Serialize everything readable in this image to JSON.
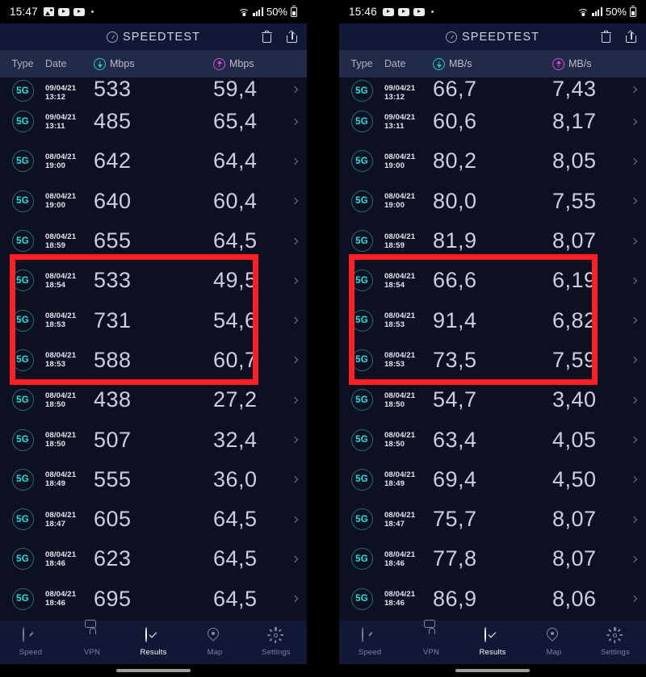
{
  "panels": [
    {
      "id": "left",
      "statusbar": {
        "time": "15:47",
        "icons": [
          "image-icon",
          "youtube-icon",
          "youtube-icon",
          "dot-icon"
        ],
        "wifi": "wifi-icon",
        "signal": "signal-bars-icon",
        "battery_pct": "50%",
        "battery": "battery-icon"
      },
      "appbar": {
        "logo": "speedometer-icon",
        "title": "SPEEDTEST",
        "delete": "trash-icon",
        "share": "share-icon"
      },
      "columns": {
        "type": "Type",
        "date": "Date",
        "download_unit": "Mbps",
        "upload_unit": "Mbps",
        "download_icon": "download-arrow-icon",
        "upload_icon": "upload-arrow-icon"
      },
      "rows": [
        {
          "type": "5G",
          "date": "09/04/21",
          "time": "13:12",
          "download": "533",
          "upload": "59,4",
          "highlighted": false,
          "partial": true
        },
        {
          "type": "5G",
          "date": "09/04/21",
          "time": "13:11",
          "download": "485",
          "upload": "65,4",
          "highlighted": false
        },
        {
          "type": "5G",
          "date": "08/04/21",
          "time": "19:00",
          "download": "642",
          "upload": "64,4",
          "highlighted": false
        },
        {
          "type": "5G",
          "date": "08/04/21",
          "time": "19:00",
          "download": "640",
          "upload": "60,4",
          "highlighted": false
        },
        {
          "type": "5G",
          "date": "08/04/21",
          "time": "18:59",
          "download": "655",
          "upload": "64,5",
          "highlighted": false
        },
        {
          "type": "5G",
          "date": "08/04/21",
          "time": "18:54",
          "download": "533",
          "upload": "49,5",
          "highlighted": true
        },
        {
          "type": "5G",
          "date": "08/04/21",
          "time": "18:53",
          "download": "731",
          "upload": "54,6",
          "highlighted": true
        },
        {
          "type": "5G",
          "date": "08/04/21",
          "time": "18:53",
          "download": "588",
          "upload": "60,7",
          "highlighted": true
        },
        {
          "type": "5G",
          "date": "08/04/21",
          "time": "18:50",
          "download": "438",
          "upload": "27,2",
          "highlighted": false
        },
        {
          "type": "5G",
          "date": "08/04/21",
          "time": "18:50",
          "download": "507",
          "upload": "32,4",
          "highlighted": false
        },
        {
          "type": "5G",
          "date": "08/04/21",
          "time": "18:49",
          "download": "555",
          "upload": "36,0",
          "highlighted": false
        },
        {
          "type": "5G",
          "date": "08/04/21",
          "time": "18:47",
          "download": "605",
          "upload": "64,5",
          "highlighted": false
        },
        {
          "type": "5G",
          "date": "08/04/21",
          "time": "18:46",
          "download": "623",
          "upload": "64,5",
          "highlighted": false
        },
        {
          "type": "5G",
          "date": "08/04/21",
          "time": "18:46",
          "download": "695",
          "upload": "64,5",
          "highlighted": false
        }
      ],
      "nav": [
        {
          "label": "Speed",
          "icon": "speedometer-icon",
          "active": false
        },
        {
          "label": "VPN",
          "icon": "lock-icon",
          "active": false
        },
        {
          "label": "Results",
          "icon": "check-circle-icon",
          "active": true
        },
        {
          "label": "Map",
          "icon": "map-pin-icon",
          "active": false
        },
        {
          "label": "Settings",
          "icon": "gear-icon",
          "active": false
        }
      ]
    },
    {
      "id": "right",
      "statusbar": {
        "time": "15:46",
        "icons": [
          "youtube-icon",
          "youtube-icon",
          "youtube-icon",
          "dot-icon"
        ],
        "wifi": "wifi-icon",
        "signal": "signal-bars-icon",
        "battery_pct": "50%",
        "battery": "battery-icon"
      },
      "appbar": {
        "logo": "speedometer-icon",
        "title": "SPEEDTEST",
        "delete": "trash-icon",
        "share": "share-icon"
      },
      "columns": {
        "type": "Type",
        "date": "Date",
        "download_unit": "MB/s",
        "upload_unit": "MB/s",
        "download_icon": "download-arrow-icon",
        "upload_icon": "upload-arrow-icon"
      },
      "rows": [
        {
          "type": "5G",
          "date": "09/04/21",
          "time": "13:12",
          "download": "66,7",
          "upload": "7,43",
          "highlighted": false,
          "partial": true
        },
        {
          "type": "5G",
          "date": "09/04/21",
          "time": "13:11",
          "download": "60,6",
          "upload": "8,17",
          "highlighted": false
        },
        {
          "type": "5G",
          "date": "08/04/21",
          "time": "19:00",
          "download": "80,2",
          "upload": "8,05",
          "highlighted": false
        },
        {
          "type": "5G",
          "date": "08/04/21",
          "time": "19:00",
          "download": "80,0",
          "upload": "7,55",
          "highlighted": false
        },
        {
          "type": "5G",
          "date": "08/04/21",
          "time": "18:59",
          "download": "81,9",
          "upload": "8,07",
          "highlighted": false
        },
        {
          "type": "5G",
          "date": "08/04/21",
          "time": "18:54",
          "download": "66,6",
          "upload": "6,19",
          "highlighted": true
        },
        {
          "type": "5G",
          "date": "08/04/21",
          "time": "18:53",
          "download": "91,4",
          "upload": "6,82",
          "highlighted": true
        },
        {
          "type": "5G",
          "date": "08/04/21",
          "time": "18:53",
          "download": "73,5",
          "upload": "7,59",
          "highlighted": true
        },
        {
          "type": "5G",
          "date": "08/04/21",
          "time": "18:50",
          "download": "54,7",
          "upload": "3,40",
          "highlighted": false
        },
        {
          "type": "5G",
          "date": "08/04/21",
          "time": "18:50",
          "download": "63,4",
          "upload": "4,05",
          "highlighted": false
        },
        {
          "type": "5G",
          "date": "08/04/21",
          "time": "18:49",
          "download": "69,4",
          "upload": "4,50",
          "highlighted": false
        },
        {
          "type": "5G",
          "date": "08/04/21",
          "time": "18:47",
          "download": "75,7",
          "upload": "8,07",
          "highlighted": false
        },
        {
          "type": "5G",
          "date": "08/04/21",
          "time": "18:46",
          "download": "77,8",
          "upload": "8,07",
          "highlighted": false
        },
        {
          "type": "5G",
          "date": "08/04/21",
          "time": "18:46",
          "download": "86,9",
          "upload": "8,06",
          "highlighted": false
        }
      ],
      "nav": [
        {
          "label": "Speed",
          "icon": "speedometer-icon",
          "active": false
        },
        {
          "label": "VPN",
          "icon": "lock-icon",
          "active": false
        },
        {
          "label": "Results",
          "icon": "check-circle-icon",
          "active": true
        },
        {
          "label": "Map",
          "icon": "map-pin-icon",
          "active": false
        },
        {
          "label": "Settings",
          "icon": "gear-icon",
          "active": false
        }
      ]
    }
  ],
  "colors": {
    "download_accent": "#17d3c5",
    "upload_accent": "#d44bd8",
    "badge_text": "#1ae3e0",
    "highlight_box": "#ff1f25",
    "app_bg": "#0c1021",
    "bar_bg": "#111735",
    "header_bg": "#232a47"
  }
}
